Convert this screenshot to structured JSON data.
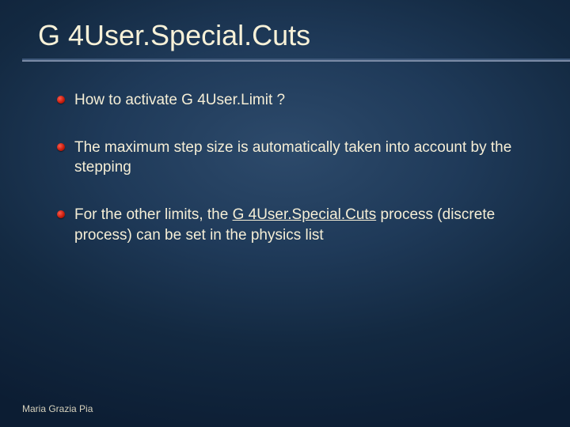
{
  "title": "G 4User.Special.Cuts",
  "bullets": [
    {
      "text": "How to activate G 4User.Limit ?"
    },
    {
      "pre": "The maximum step size is automatically taken into account by the stepping"
    },
    {
      "pre": "For the other limits, the ",
      "hl": "G 4User.Special.Cuts",
      "post": " process (discrete process) can be set in the physics list"
    }
  ],
  "footer": "Maria Grazia Pia"
}
